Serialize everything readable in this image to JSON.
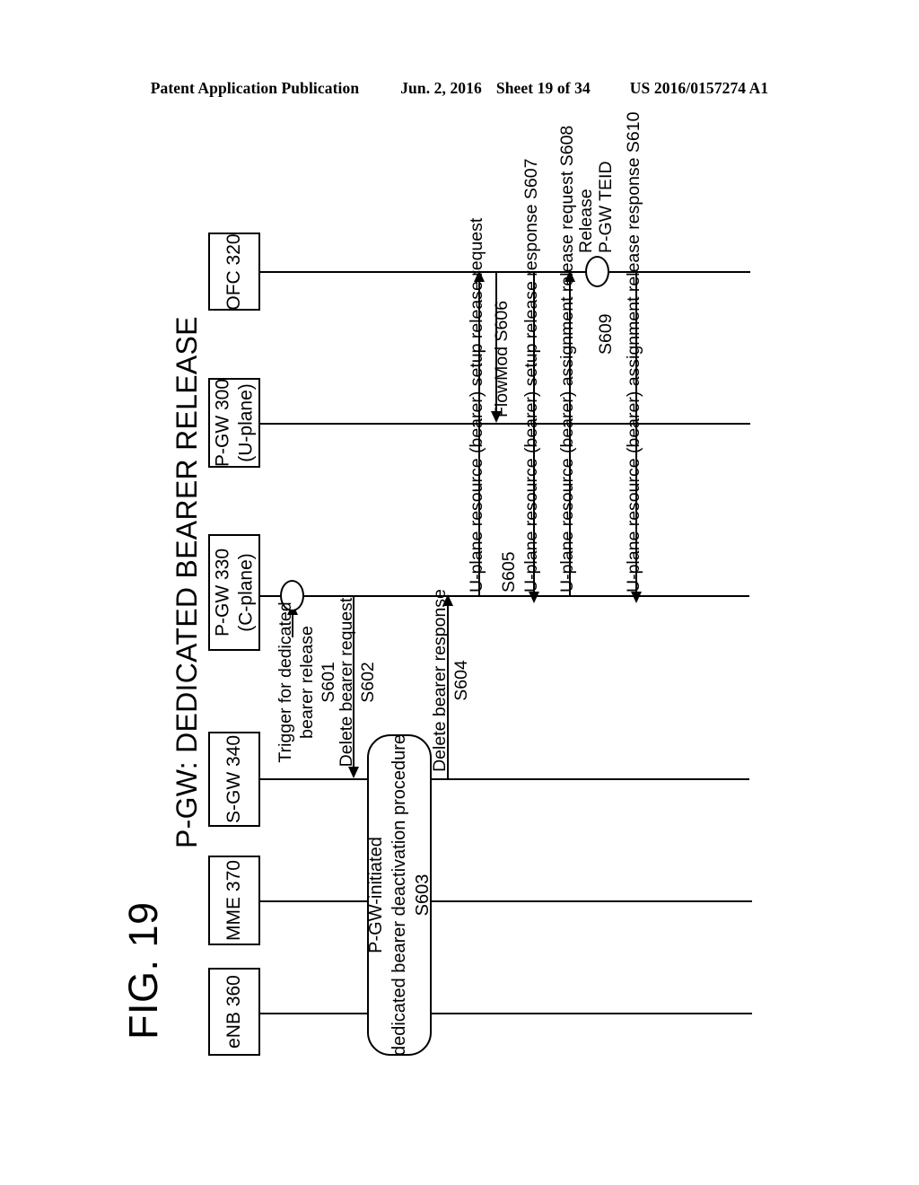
{
  "header": {
    "publication": "Patent Application Publication",
    "date": "Jun. 2, 2016",
    "sheet": "Sheet 19 of 34",
    "patent_number": "US 2016/0157274 A1"
  },
  "figure": {
    "number": "FIG. 19",
    "title": "P-GW: DEDICATED BEARER RELEASE"
  },
  "nodes": [
    {
      "id": "ofc320",
      "label": "OFC 320"
    },
    {
      "id": "pgw300u",
      "label_line1": "P-GW 300",
      "label_line2": "(U-plane)"
    },
    {
      "id": "pgw330c",
      "label_line1": "P-GW 330",
      "label_line2": "(C-plane)"
    },
    {
      "id": "sgw340",
      "label": "S-GW 340"
    },
    {
      "id": "mme370",
      "label": "MME 370"
    },
    {
      "id": "enb360",
      "label": "eNB 360"
    }
  ],
  "messages": [
    {
      "id": "s601",
      "text_line1": "Trigger for dedicated",
      "text_line2": "bearer release",
      "step": "S601"
    },
    {
      "id": "s602",
      "text_line1": "Delete bearer request",
      "step": "S602"
    },
    {
      "id": "s603",
      "text_line1": "P-GW-initiated",
      "text_line2": "dedicated bearer deactivation procedure",
      "step": "S603"
    },
    {
      "id": "s604",
      "text_line1": "Delete bearer response",
      "step": "S604"
    },
    {
      "id": "s605",
      "text_line1": "U-plane resource (bearer) setup release request",
      "step": "S605"
    },
    {
      "id": "s606",
      "text_line1": "FlowMod  S606",
      "step": "S606"
    },
    {
      "id": "s607",
      "text_line1": "U-plane resource (bearer) setup release response S607",
      "step": "S607"
    },
    {
      "id": "s608",
      "text_line1": "U-plane resource (bearer) assignment release request S608",
      "step": "S608"
    },
    {
      "id": "s609",
      "text_line1": "Release",
      "text_line2": "P-GW TEID",
      "step": "S609"
    },
    {
      "id": "s610",
      "text_line1": "U-plane resource (bearer) assignment release response S610",
      "step": "S610"
    }
  ],
  "colors": {
    "ink": "#000000",
    "paper": "#ffffff"
  }
}
